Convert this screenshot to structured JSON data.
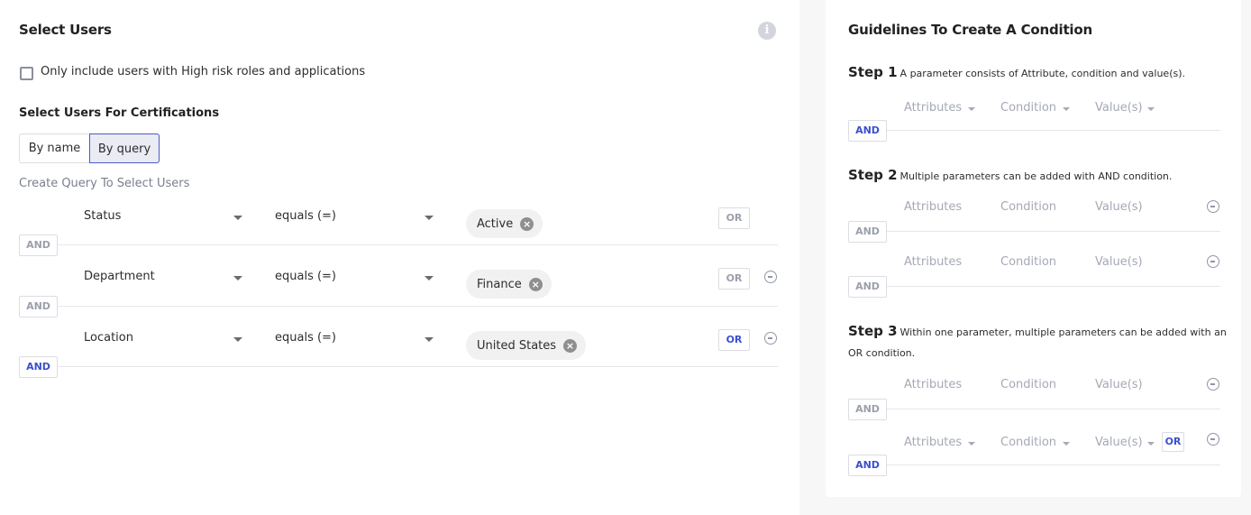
{
  "left": {
    "title": "Select Users",
    "info_icon": "info-icon",
    "checkbox": {
      "label": "Only include users with High risk roles and applications",
      "checked": false
    },
    "subtitle": "Select Users For Certifications",
    "toggle": {
      "options": [
        "By name",
        "By query"
      ],
      "selected": "By query"
    },
    "query_label": "Create Query To Select Users",
    "rows": [
      {
        "attribute": "Status",
        "condition": "equals (=)",
        "values": [
          "Active"
        ],
        "or_label": "OR",
        "or_active": false,
        "removable": false,
        "and_label": "AND",
        "and_active": false
      },
      {
        "attribute": "Department",
        "condition": "equals (=)",
        "values": [
          "Finance"
        ],
        "or_label": "OR",
        "or_active": false,
        "removable": true,
        "and_label": "AND",
        "and_active": false
      },
      {
        "attribute": "Location",
        "condition": "equals (=)",
        "values": [
          "United States"
        ],
        "or_label": "OR",
        "or_active": true,
        "removable": true,
        "and_label": "AND",
        "and_active": true
      }
    ]
  },
  "guide": {
    "title": "Guidelines To Create A Condition",
    "columns": [
      "Attributes",
      "Condition",
      "Value(s)"
    ],
    "and_label": "AND",
    "or_label": "OR",
    "steps": [
      {
        "label": "Step 1",
        "text": "A parameter consists of Attribute, condition and value(s).",
        "text_cont": ""
      },
      {
        "label": "Step 2",
        "text": "Multiple parameters can be added with AND condition.",
        "text_cont": ""
      },
      {
        "label": "Step 3",
        "text": "Within one parameter, multiple parameters can be added with an",
        "text_cont": "OR condition."
      }
    ]
  },
  "colors": {
    "accent": "#3a4fd0",
    "toggle_selected_bg": "#eaebf3",
    "chip_bg": "#f1f1f1",
    "panel_bg": "#f7f7f7"
  }
}
